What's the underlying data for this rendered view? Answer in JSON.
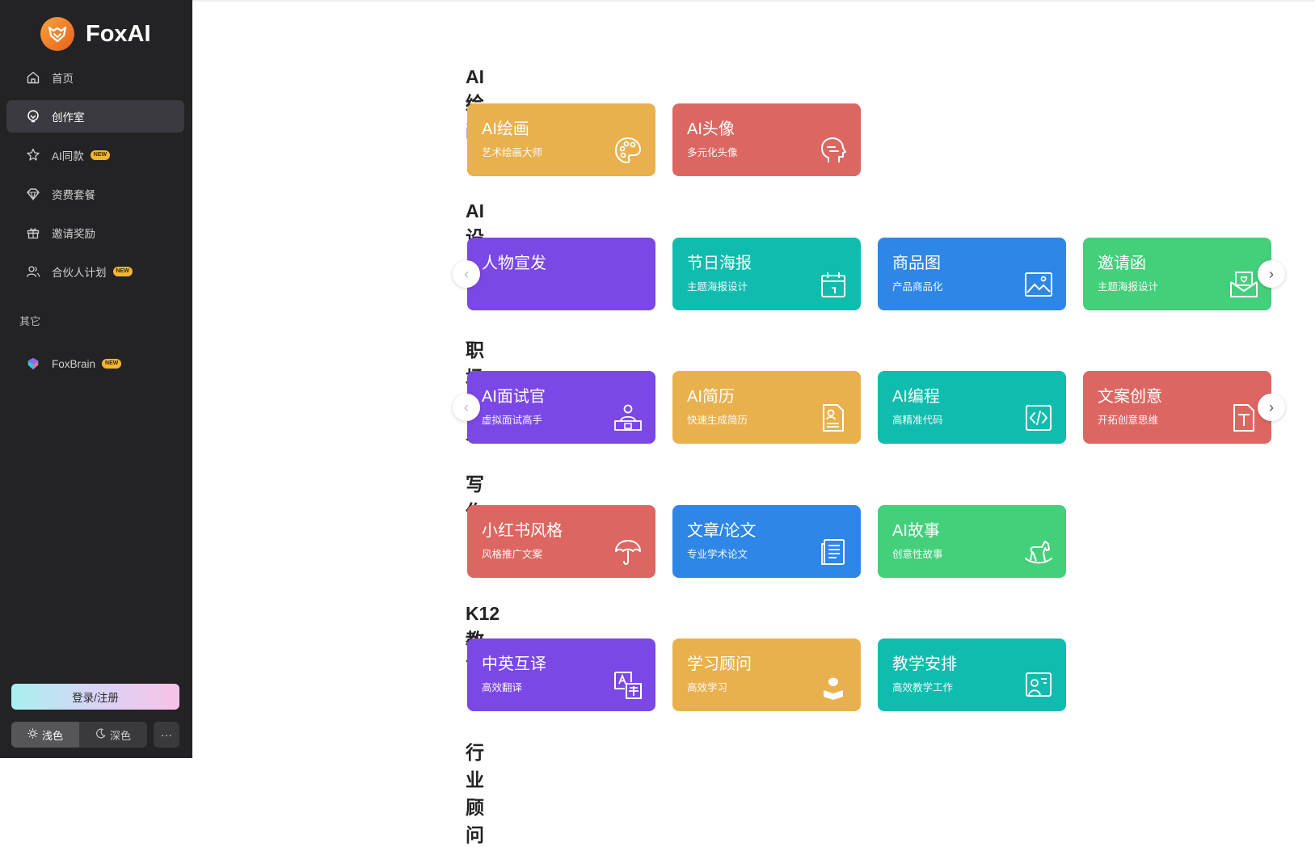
{
  "app": {
    "name": "FoxAI"
  },
  "sidebar": {
    "items": [
      {
        "label": "首页",
        "icon": "home-icon"
      },
      {
        "label": "创作室",
        "icon": "creation-icon",
        "active": true
      },
      {
        "label": "AI同款",
        "icon": "magic-icon",
        "badge": "NEW"
      },
      {
        "label": "资费套餐",
        "icon": "diamond-icon"
      },
      {
        "label": "邀请奖励",
        "icon": "gift-icon"
      },
      {
        "label": "合伙人计划",
        "icon": "partners-icon",
        "badge": "NEW"
      }
    ],
    "other_label": "其它",
    "other_items": [
      {
        "label": "FoxBrain",
        "icon": "brain-icon",
        "badge": "NEW"
      }
    ],
    "login_label": "登录/注册",
    "theme_light": "浅色",
    "theme_dark": "深色",
    "more": "···"
  },
  "sections": [
    {
      "title": "AI绘画",
      "cards": [
        {
          "title": "AI绘画",
          "subtitle": "艺术绘画大师",
          "color": "#e9b04e",
          "icon": "palette-icon"
        },
        {
          "title": "AI头像",
          "subtitle": "多元化头像",
          "color": "#dc6762",
          "icon": "face-icon"
        }
      ]
    },
    {
      "title": "AI设计",
      "cards": [
        {
          "title": "人物宣发",
          "subtitle": "",
          "color": "#7b48e6",
          "icon": ""
        },
        {
          "title": "节日海报",
          "subtitle": "主题海报设计",
          "color": "#0fbcae",
          "icon": "calendar-icon"
        },
        {
          "title": "商品图",
          "subtitle": "产品商品化",
          "color": "#2e86e6",
          "icon": "image-icon"
        },
        {
          "title": "邀请函",
          "subtitle": "主题海报设计",
          "color": "#44cf7b",
          "icon": "envelope-icon"
        }
      ]
    },
    {
      "title": "职场达人",
      "cards": [
        {
          "title": "AI面试官",
          "subtitle": "虚拟面试高手",
          "color": "#7b48e6",
          "icon": "interview-icon"
        },
        {
          "title": "AI简历",
          "subtitle": "快速生成简历",
          "color": "#e9b04e",
          "icon": "resume-icon"
        },
        {
          "title": "AI编程",
          "subtitle": "高精准代码",
          "color": "#0fbcae",
          "icon": "code-icon"
        },
        {
          "title": "文案创意",
          "subtitle": "开拓创意思维",
          "color": "#dc6762",
          "icon": "text-doc-icon"
        }
      ]
    },
    {
      "title": "写作",
      "cards": [
        {
          "title": "小红书风格",
          "subtitle": "风格推广文案",
          "color": "#dc6762",
          "icon": "umbrella-icon"
        },
        {
          "title": "文章/论文",
          "subtitle": "专业学术论文",
          "color": "#2e86e6",
          "icon": "paper-icon"
        },
        {
          "title": "AI故事",
          "subtitle": "创意性故事",
          "color": "#44cf7b",
          "icon": "rocking-horse-icon"
        }
      ]
    },
    {
      "title": "K12教育",
      "cards": [
        {
          "title": "中英互译",
          "subtitle": "高效翻译",
          "color": "#7b48e6",
          "icon": "translate-icon"
        },
        {
          "title": "学习顾问",
          "subtitle": "高效学习",
          "color": "#e9b04e",
          "icon": "student-icon"
        },
        {
          "title": "教学安排",
          "subtitle": "高效教学工作",
          "color": "#0fbcae",
          "icon": "teacher-icon"
        }
      ]
    },
    {
      "title": "行业顾问",
      "cards": []
    }
  ]
}
